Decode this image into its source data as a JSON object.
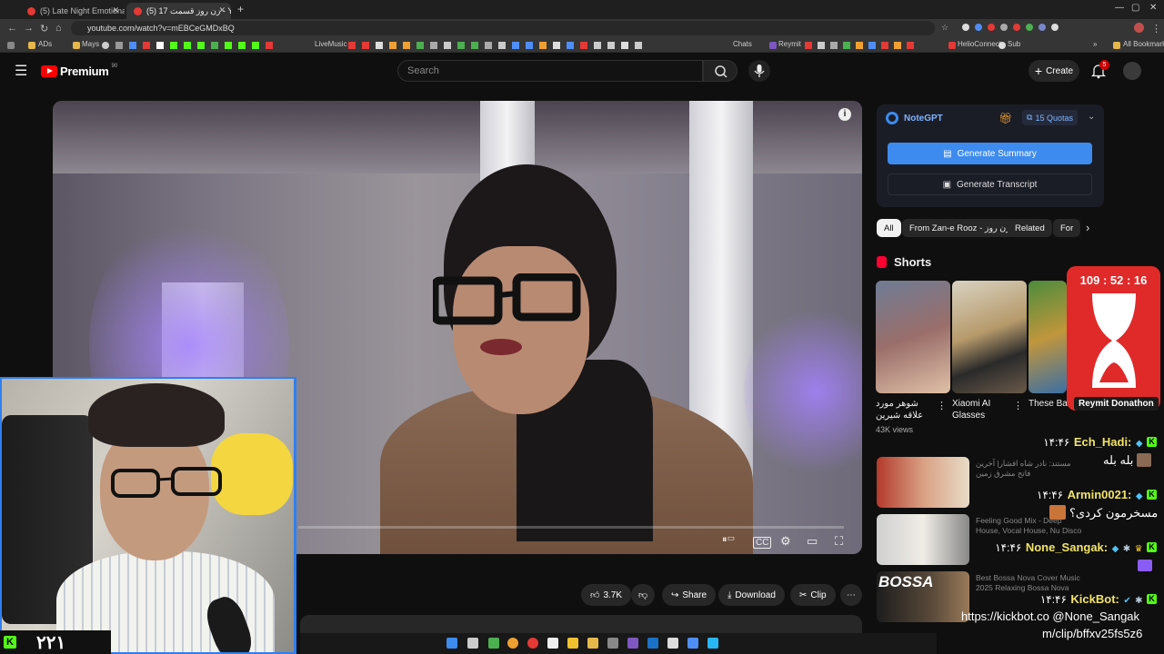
{
  "tabs": [
    {
      "label": "(5) Late Night Emotional House",
      "active": false
    },
    {
      "label": "(5) زن روز قسمت 17 - YouTube",
      "active": true
    }
  ],
  "address": {
    "url": "youtube.com/watch?v=mEBCeGMDxBQ"
  },
  "bookmarks": [
    "ADs",
    "Mays",
    "LiveMusic",
    "Chats",
    "Reymit",
    "HelioConnect",
    "Sub",
    "All Bookmarks"
  ],
  "header": {
    "logo_text": "Premium",
    "logo_sup": "90",
    "search_placeholder": "Search",
    "create_label": "Create",
    "notif_count": "5"
  },
  "video": {
    "actions": {
      "likes": "3.7K",
      "share": "Share",
      "download": "Download",
      "clip": "Clip"
    }
  },
  "notegpt": {
    "title": "NoteGPT",
    "quotas": "15 Quotas",
    "generate_summary": "Generate Summary",
    "generate_transcript": "Generate Transcript"
  },
  "chips": [
    "All",
    "From Zan-e Rooz - زن روز",
    "Related",
    "For"
  ],
  "shorts": {
    "heading": "Shorts",
    "items": [
      {
        "title": "شوهر مورد علاقه شیرین",
        "views": "43K views"
      },
      {
        "title": "Xiaomi AI Glasses",
        "views": ""
      },
      {
        "title": "These Ba... are Out of",
        "views": ""
      }
    ]
  },
  "timer": {
    "time": "109 : 52 : 16",
    "label": "Reymit Donathon"
  },
  "recommended": [
    {
      "text": "مستند: نادر شاه افشار| آخرین فاتح مشرق زمین"
    },
    {
      "text": "Feeling Good Mix - Deep House, Vocal House, Nu Disco"
    },
    {
      "text": "Best Bossa Nova Cover Music 2025 Relaxing Bossa Nova",
      "thumb_word": "BOSSA"
    }
  ],
  "chat": [
    {
      "time": "۱۴:۴۶",
      "name": "Ech_Hadi:",
      "msg": "بله بله"
    },
    {
      "time": "۱۴:۴۶",
      "name": "Armin0021:",
      "msg": "مسخرمون کردی؟"
    },
    {
      "time": "۱۴:۴۶",
      "name": "None_Sangak:",
      "msg": ""
    },
    {
      "time": "۱۴:۴۶",
      "name": "KickBot:",
      "msg": "https://kickbot.co @None_Sangak",
      "msg2": "m/clip/bffxv25fs5z6"
    }
  ],
  "webcam": {
    "viewer_count": "۲۲۱"
  }
}
